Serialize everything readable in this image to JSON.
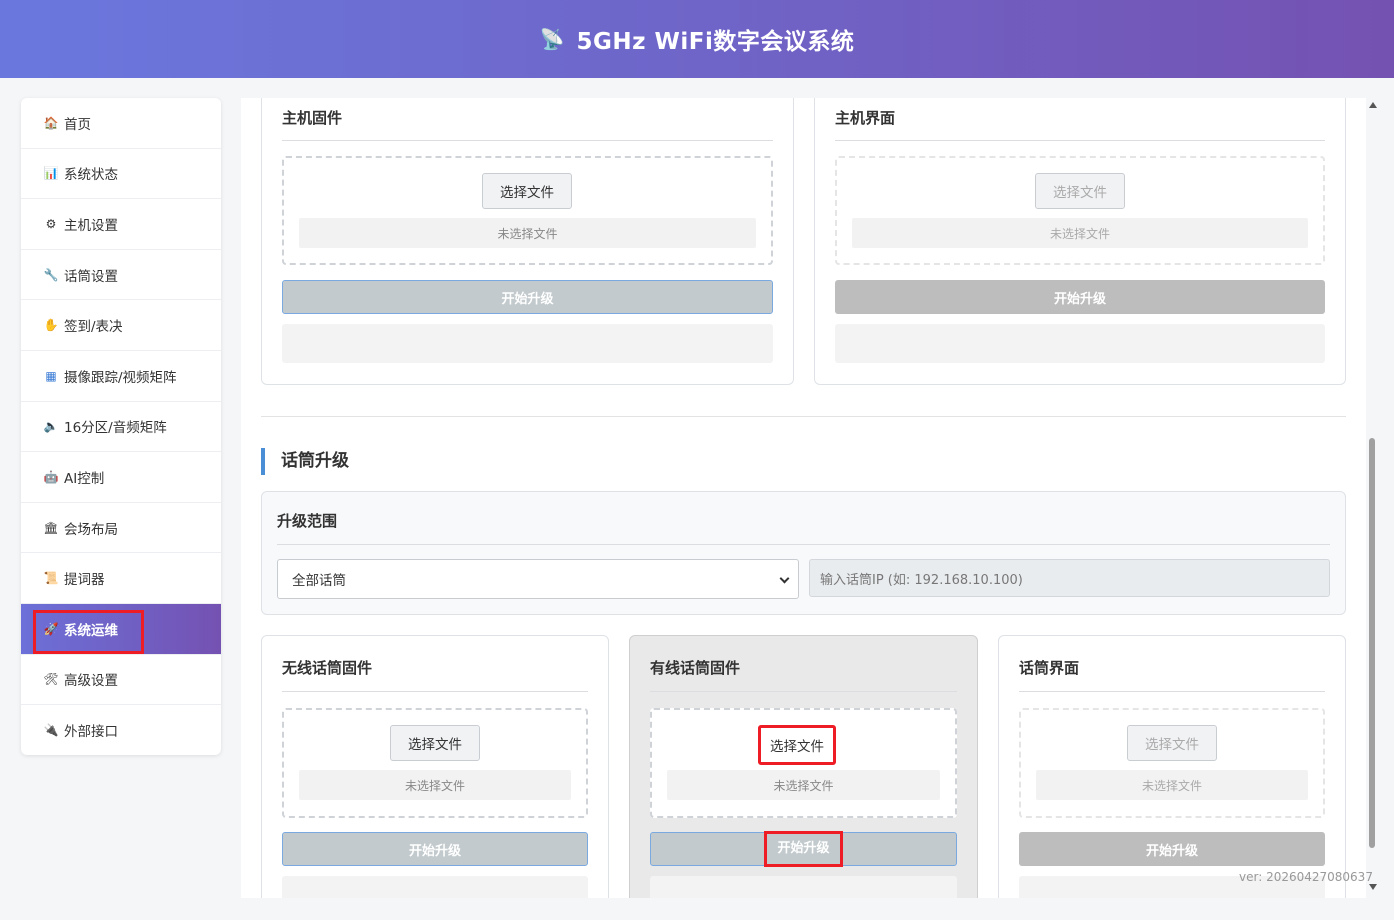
{
  "header": {
    "logo_icon": "satellite-dish-icon",
    "logo_glyph": "📡",
    "title": "5GHz WiFi数字会议系统"
  },
  "sidebar": {
    "items": [
      {
        "label": "首页",
        "icon": "house-icon",
        "glyph": "🏠"
      },
      {
        "label": "系统状态",
        "icon": "bar-chart-icon",
        "glyph": "📊"
      },
      {
        "label": "主机设置",
        "icon": "gear-icon",
        "glyph": "⚙"
      },
      {
        "label": "话筒设置",
        "icon": "wrench-icon",
        "glyph": "🔧"
      },
      {
        "label": "签到/表决",
        "icon": "hand-icon",
        "glyph": "✋"
      },
      {
        "label": "摄像跟踪/视频矩阵",
        "icon": "grid-icon",
        "glyph": "▦"
      },
      {
        "label": "16分区/音频矩阵",
        "icon": "speaker-icon",
        "glyph": "🔈"
      },
      {
        "label": "AI控制",
        "icon": "robot-icon",
        "glyph": "🤖"
      },
      {
        "label": "会场布局",
        "icon": "building-icon",
        "glyph": "🏛"
      },
      {
        "label": "提词器",
        "icon": "scroll-icon",
        "glyph": "📜"
      },
      {
        "label": "系统运维",
        "icon": "rocket-icon",
        "glyph": "🚀",
        "active": true
      },
      {
        "label": "高级设置",
        "icon": "tools-icon",
        "glyph": "🛠"
      },
      {
        "label": "外部接口",
        "icon": "plug-icon",
        "glyph": "🔌"
      }
    ]
  },
  "host_section": {
    "firmware": {
      "title": "主机固件",
      "choose_label": "选择文件",
      "file_status": "未选择文件",
      "upgrade_label": "开始升级"
    },
    "ui": {
      "title": "主机界面",
      "choose_label": "选择文件",
      "file_status": "未选择文件",
      "upgrade_label": "开始升级"
    }
  },
  "mic_section": {
    "title": "话筒升级",
    "scope": {
      "title": "升级范围",
      "selected": "全部话筒",
      "ip_placeholder": "输入话筒IP (如: 192.168.10.100)"
    },
    "wireless": {
      "title": "无线话筒固件",
      "choose_label": "选择文件",
      "file_status": "未选择文件",
      "upgrade_label": "开始升级"
    },
    "wired": {
      "title": "有线话筒固件",
      "choose_label": "选择文件",
      "file_status": "未选择文件",
      "upgrade_label": "开始升级"
    },
    "ui": {
      "title": "话筒界面",
      "choose_label": "选择文件",
      "file_status": "未选择文件",
      "upgrade_label": "开始升级"
    }
  },
  "version": "ver: 20260427080637",
  "colors": {
    "header_start": "#6a78de",
    "header_end": "#7452b2",
    "accent": "#4a8fd6",
    "highlight": "#ee1c25"
  }
}
